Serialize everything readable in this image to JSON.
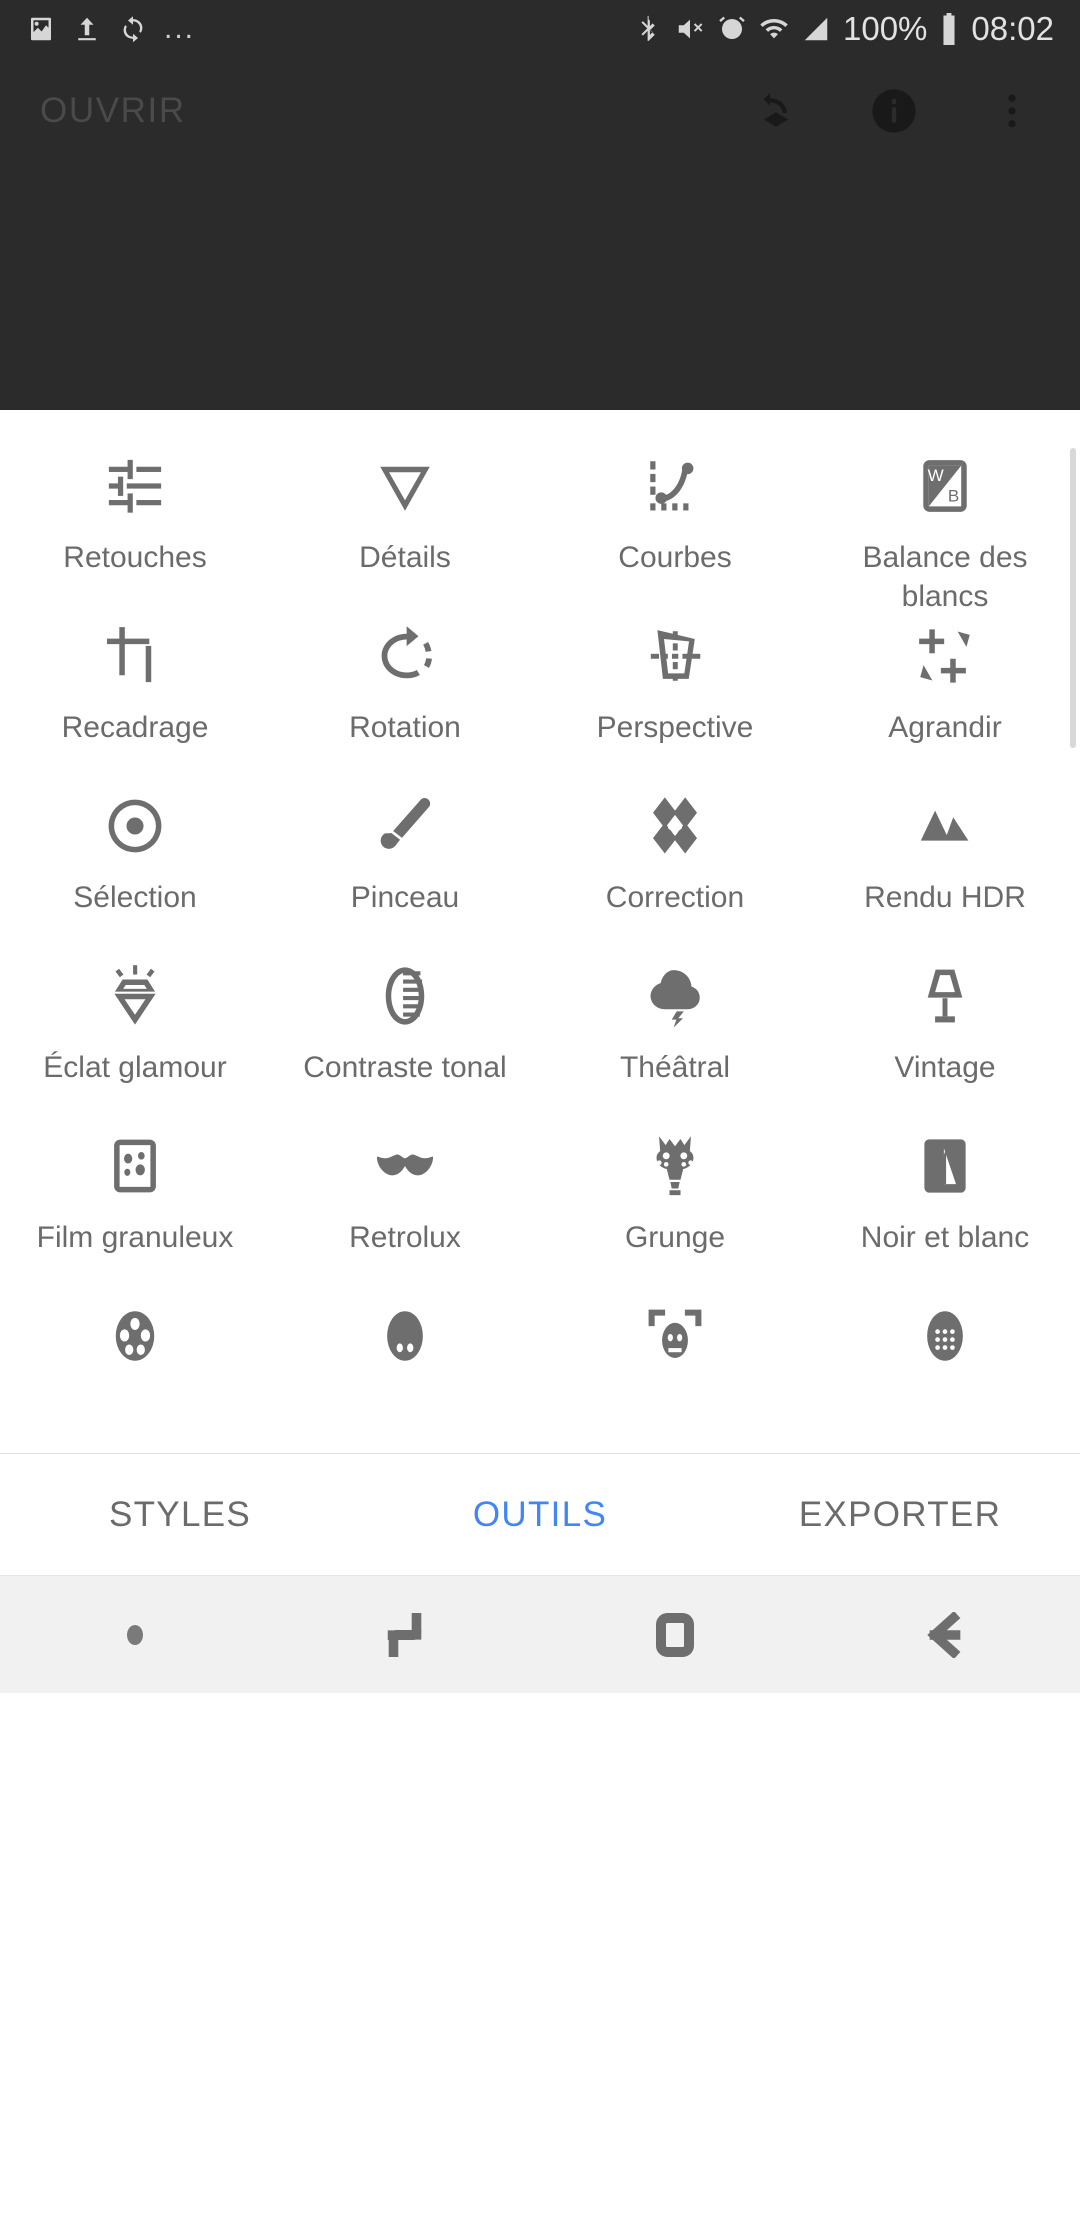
{
  "statusbar": {
    "left_icons": [
      "image-icon",
      "upload-icon",
      "sync-icon",
      "more-icon"
    ],
    "ellipsis": "...",
    "right_icons": [
      "bluetooth-icon",
      "mute-vibrate-icon",
      "alarm-icon",
      "wifi-icon",
      "signal-icon"
    ],
    "battery_percent": "100%",
    "time": "08:02"
  },
  "toolbar": {
    "title": "OUVRIR",
    "actions": [
      {
        "name": "revert-stack-icon",
        "label": "Rétablir"
      },
      {
        "name": "info-icon",
        "label": "Informations"
      },
      {
        "name": "overflow-menu-icon",
        "label": "Plus d'options"
      }
    ]
  },
  "tools": [
    {
      "label": "Retouches",
      "icon": "tune-icon"
    },
    {
      "label": "Détails",
      "icon": "triangle-down-icon"
    },
    {
      "label": "Courbes",
      "icon": "curves-icon"
    },
    {
      "label": "Balance des blancs",
      "icon": "white-balance-icon"
    },
    {
      "label": "Recadrage",
      "icon": "crop-icon"
    },
    {
      "label": "Rotation",
      "icon": "rotate-icon"
    },
    {
      "label": "Perspective",
      "icon": "perspective-icon"
    },
    {
      "label": "Agrandir",
      "icon": "expand-icon"
    },
    {
      "label": "Sélection",
      "icon": "selective-icon"
    },
    {
      "label": "Pinceau",
      "icon": "brush-icon"
    },
    {
      "label": "Correction",
      "icon": "healing-icon"
    },
    {
      "label": "Rendu HDR",
      "icon": "hdr-mountains-icon"
    },
    {
      "label": "Éclat glamour",
      "icon": "glamour-glow-icon"
    },
    {
      "label": "Contraste tonal",
      "icon": "tonal-contrast-icon"
    },
    {
      "label": "Théâtral",
      "icon": "drama-cloud-icon"
    },
    {
      "label": "Vintage",
      "icon": "vintage-lamp-icon"
    },
    {
      "label": "Film granuleux",
      "icon": "grainy-film-icon"
    },
    {
      "label": "Retrolux",
      "icon": "retrolux-moustache-icon"
    },
    {
      "label": "Grunge",
      "icon": "grunge-icon"
    },
    {
      "label": "Noir et blanc",
      "icon": "black-white-icon"
    },
    {
      "label": "",
      "icon": "film-reel-icon"
    },
    {
      "label": "",
      "icon": "portrait-icon"
    },
    {
      "label": "",
      "icon": "face-frame-icon"
    },
    {
      "label": "",
      "icon": "head-pose-icon"
    }
  ],
  "tabs": [
    {
      "label": "STYLES",
      "active": false
    },
    {
      "label": "OUTILS",
      "active": true
    },
    {
      "label": "EXPORTER",
      "active": false
    }
  ],
  "navbar": {
    "items": [
      "menu-dot-icon",
      "recents-icon",
      "home-icon",
      "back-icon"
    ]
  },
  "colors": {
    "accent": "#4285f4",
    "dark_chrome": "#2b2b2b",
    "icon_grey": "#6e6e6e",
    "label_grey": "#6b6b6b"
  }
}
